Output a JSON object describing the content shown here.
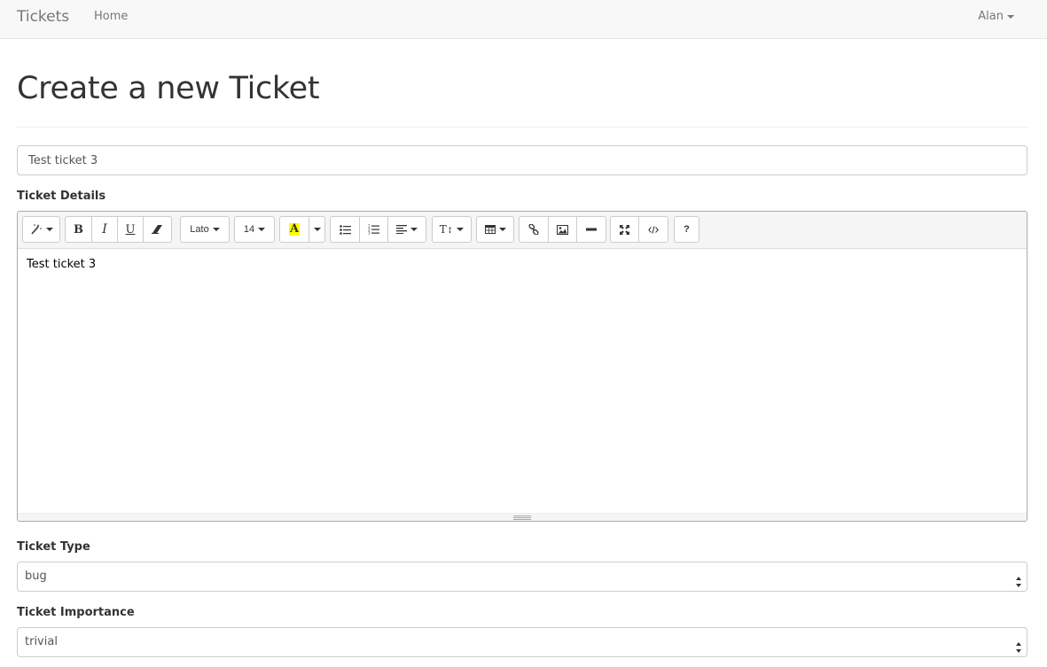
{
  "navbar": {
    "brand": "Tickets",
    "home": "Home",
    "user": "Alan"
  },
  "page": {
    "title": "Create a new Ticket"
  },
  "form": {
    "title_value": "Test ticket 3",
    "details_label": "Ticket Details",
    "details_content": "Test ticket 3",
    "type_label": "Ticket Type",
    "type_value": "bug",
    "importance_label": "Ticket Importance",
    "importance_value": "trivial"
  },
  "toolbar": {
    "style_icon": "magic-wand-icon",
    "bold": "B",
    "italic": "I",
    "underline": "U",
    "clear_icon": "eraser-icon",
    "font_name": "Lato",
    "font_size": "14",
    "color_letter": "A",
    "highlight_color": "#ffff00",
    "ul_icon": "unordered-list-icon",
    "ol_icon": "ordered-list-icon",
    "align_icon": "align-left-icon",
    "height_label": "T",
    "table_icon": "table-icon",
    "link_icon": "link-icon",
    "image_icon": "image-icon",
    "hr_icon": "horizontal-rule-icon",
    "fullscreen_icon": "fullscreen-icon",
    "codeview_icon": "code-view-icon",
    "help": "?"
  }
}
